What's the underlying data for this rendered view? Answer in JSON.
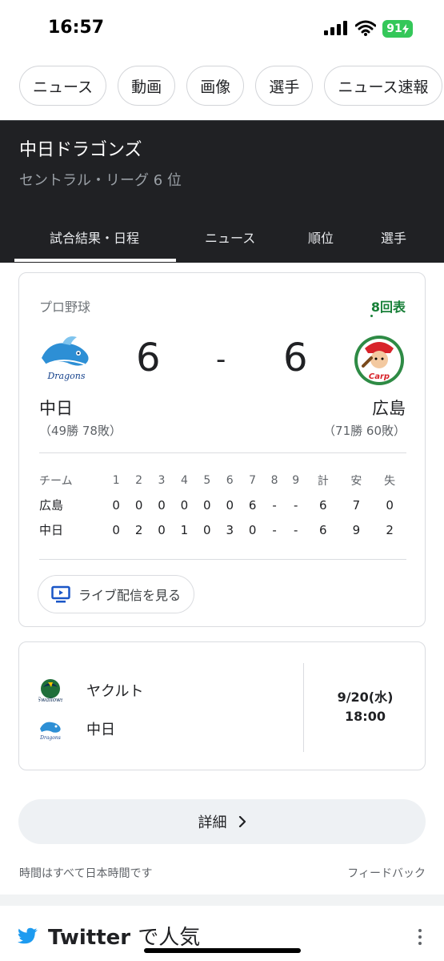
{
  "status_bar": {
    "time": "16:57",
    "battery": "91"
  },
  "chips": [
    "ニュース",
    "動画",
    "画像",
    "選手",
    "ニュース速報"
  ],
  "team_header": {
    "title": "中日ドラゴンズ",
    "subtitle": "セントラル・リーグ 6 位",
    "tabs": [
      "試合結果・日程",
      "ニュース",
      "順位",
      "選手"
    ],
    "active_tab": 0
  },
  "game": {
    "league": "プロ野球",
    "inning": "8回表",
    "home": {
      "name": "中日",
      "record": "（49勝 78敗）",
      "score": "6"
    },
    "away": {
      "name": "広島",
      "record": "（71勝 60敗）",
      "score": "6"
    },
    "dash": "-",
    "boxscore": {
      "headers": [
        "チーム",
        "1",
        "2",
        "3",
        "4",
        "5",
        "6",
        "7",
        "8",
        "9",
        "計",
        "安",
        "失"
      ],
      "rows": [
        [
          "広島",
          "0",
          "0",
          "0",
          "0",
          "0",
          "0",
          "6",
          "-",
          "-",
          "6",
          "7",
          "0"
        ],
        [
          "中日",
          "0",
          "2",
          "0",
          "1",
          "0",
          "3",
          "0",
          "-",
          "-",
          "6",
          "9",
          "2"
        ]
      ]
    },
    "live_button": "ライブ配信を見る"
  },
  "next_game": {
    "team1": "ヤクルト",
    "team2": "中日",
    "date": "9/20(水)",
    "time": "18:00"
  },
  "detail_button": "詳細",
  "footer_note": "時間はすべて日本時間です",
  "feedback": "フィードバック",
  "twitter": {
    "brand": "Twitter",
    "suffix": "で人気"
  },
  "colors": {
    "inning_green": "#188038",
    "header_bg": "#202124",
    "battery_green": "#34c759",
    "twitter_blue": "#1d9bf0"
  }
}
